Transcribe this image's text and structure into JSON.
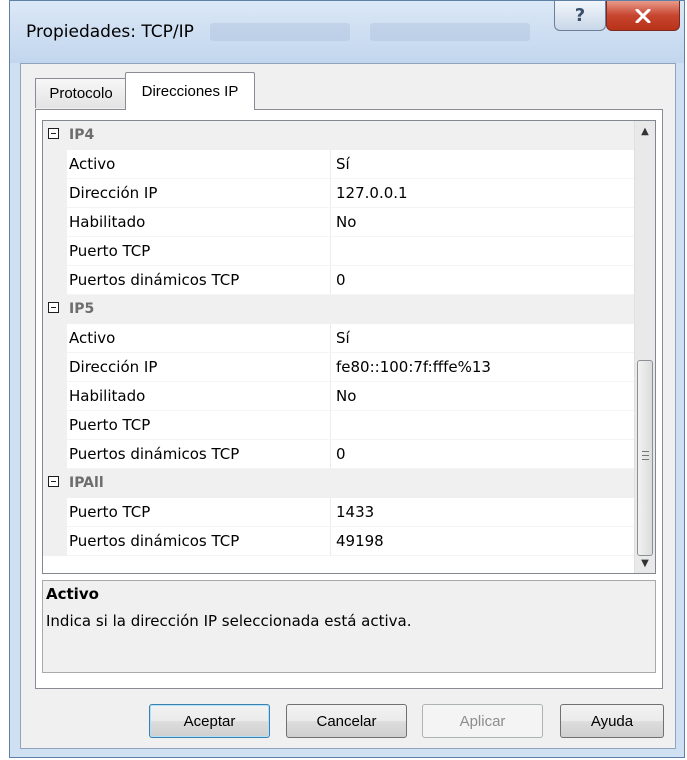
{
  "window": {
    "title": "Propiedades: TCP/IP"
  },
  "titlebar_buttons": {
    "help_icon": "question-icon",
    "close_icon": "close-icon"
  },
  "tabs": [
    {
      "label": "Protocolo"
    },
    {
      "label": "Direcciones IP"
    }
  ],
  "grid": {
    "rows": [
      {
        "kind": "category",
        "name": "IP4"
      },
      {
        "kind": "item",
        "name": "Activo",
        "value": "Sí"
      },
      {
        "kind": "item",
        "name": "Dirección IP",
        "value": "127.0.0.1"
      },
      {
        "kind": "item",
        "name": "Habilitado",
        "value": "No"
      },
      {
        "kind": "item",
        "name": "Puerto TCP",
        "value": ""
      },
      {
        "kind": "item",
        "name": "Puertos dinámicos TCP",
        "value": "0"
      },
      {
        "kind": "category",
        "name": "IP5"
      },
      {
        "kind": "item",
        "name": "Activo",
        "value": "Sí"
      },
      {
        "kind": "item",
        "name": "Dirección IP",
        "value": "fe80::100:7f:fffe%13"
      },
      {
        "kind": "item",
        "name": "Habilitado",
        "value": "No"
      },
      {
        "kind": "item",
        "name": "Puerto TCP",
        "value": ""
      },
      {
        "kind": "item",
        "name": "Puertos dinámicos TCP",
        "value": "0"
      },
      {
        "kind": "category",
        "name": "IPAll"
      },
      {
        "kind": "item",
        "name": "Puerto TCP",
        "value": "1433"
      },
      {
        "kind": "item",
        "name": "Puertos dinámicos TCP",
        "value": "49198"
      }
    ]
  },
  "description": {
    "title": "Activo",
    "text": "Indica si la dirección IP seleccionada está activa."
  },
  "buttons": {
    "ok": "Aceptar",
    "cancel": "Cancelar",
    "apply": "Aplicar",
    "help": "Ayuda"
  },
  "colors": {
    "window_frame": "#cfe0f2",
    "close_button": "#c7452f",
    "category_text": "#6d6d6d"
  }
}
